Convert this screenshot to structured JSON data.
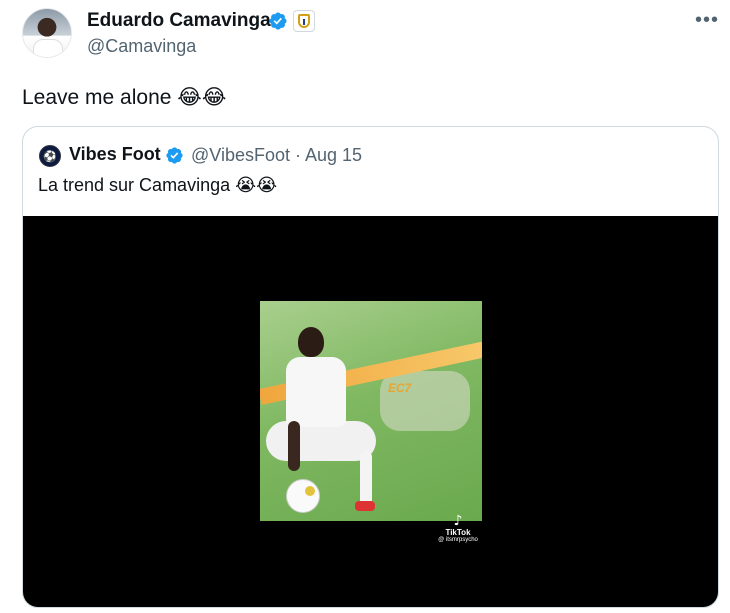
{
  "tweet": {
    "author_name": "Eduardo Camavinga",
    "handle": "@Camavinga",
    "text": "Leave me alone 😂😂",
    "more_icon": "•••"
  },
  "quote": {
    "avatar_glyph": "⚽",
    "author_name": "Vibes Foot",
    "handle_date": "@VibesFoot · Aug 15",
    "text": "La trend sur Camavinga 😭😭",
    "video": {
      "overlay_tag": "EC7",
      "watermark_logo": "♪",
      "watermark_brand": "TikTok",
      "watermark_user": "@ itsmrpsycho"
    }
  },
  "colors": {
    "verified": "#1d9bf0",
    "text_primary": "#0f1419",
    "text_secondary": "#536471",
    "border": "#cfd9de"
  },
  "icons": [
    "verified-badge-icon",
    "club-badge-icon",
    "more-options-icon",
    "tiktok-logo-icon"
  ]
}
